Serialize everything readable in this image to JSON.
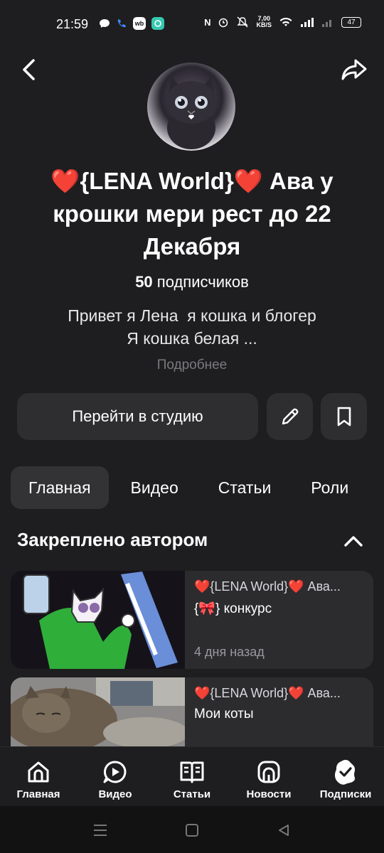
{
  "status_bar": {
    "time": "21:59",
    "speed_value": "7,00",
    "speed_unit": "KB/S",
    "battery": "47",
    "nfc": "N",
    "wb": "wb"
  },
  "channel": {
    "title": "❤️{LENA World}❤️ Ава у крошки мери рест до 22 Декабря",
    "subscribers_count": "50",
    "subscribers_label": "подписчиков",
    "description_line1": "Привет я Лена  я кошка и блогер",
    "description_line2": "Я кошка белая ...",
    "more_label": "Подробнее"
  },
  "actions": {
    "studio_label": "Перейти в студию"
  },
  "tabs": [
    {
      "label": "Главная",
      "active": true
    },
    {
      "label": "Видео",
      "active": false
    },
    {
      "label": "Статьи",
      "active": false
    },
    {
      "label": "Роли",
      "active": false
    }
  ],
  "pinned": {
    "title": "Закреплено автором",
    "items": [
      {
        "channel": "❤️{LENA World}❤️ Ава...",
        "title": "{🎀} конкурс",
        "time": "4 дня назад"
      },
      {
        "channel": "❤️{LENA World}❤️ Ава...",
        "title": "Мои коты",
        "time": ""
      }
    ]
  },
  "bottom_nav": [
    {
      "label": "Главная",
      "icon": "home-icon"
    },
    {
      "label": "Видео",
      "icon": "video-icon"
    },
    {
      "label": "Статьи",
      "icon": "articles-icon"
    },
    {
      "label": "Новости",
      "icon": "news-icon"
    },
    {
      "label": "Подписки",
      "icon": "subscriptions-icon"
    }
  ],
  "colors": {
    "background": "#1e1e20",
    "surface": "#2e2e31",
    "muted_text": "#7a7a7e"
  }
}
